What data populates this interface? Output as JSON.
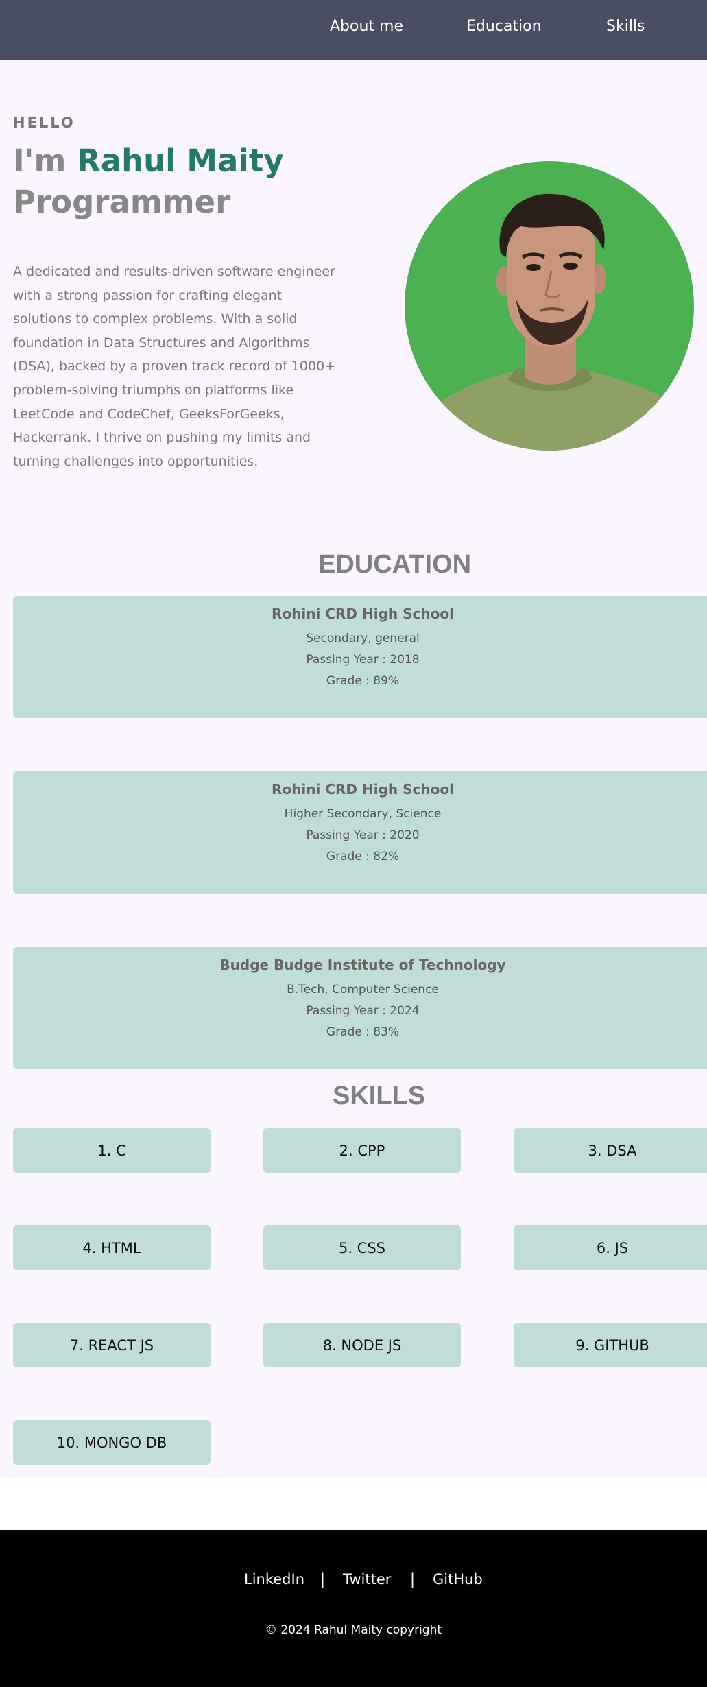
{
  "nav": {
    "items": [
      "About me",
      "Education",
      "Skills"
    ]
  },
  "hero": {
    "hello": "HELLO",
    "intro": "I'm",
    "name": "Rahul Maity",
    "role": "Programmer",
    "bio": "A dedicated and results-driven software engineer with a strong passion for crafting elegant solutions to complex problems. With a solid foundation in Data Structures and Algorithms (DSA), backed by a proven track record of 1000+ problem-solving triumphs on platforms like LeetCode and CodeChef, GeeksForGeeks, Hackerrank. I thrive on pushing my limits and turning challenges into opportunities."
  },
  "education": {
    "title": "EDUCATION",
    "items": [
      {
        "school": "Rohini CRD High School",
        "level": "Secondary, general",
        "year": "Passing Year : 2018",
        "grade": "Grade : 89%"
      },
      {
        "school": "Rohini CRD High School",
        "level": "Higher Secondary, Science",
        "year": "Passing Year : 2020",
        "grade": "Grade : 82%"
      },
      {
        "school": "Budge Budge Institute of Technology",
        "level": "B.Tech, Computer Science",
        "year": "Passing Year : 2024",
        "grade": "Grade : 83%"
      }
    ]
  },
  "skills": {
    "title": "SKILLS",
    "items": [
      "1. C",
      "2. CPP",
      "3. DSA",
      "4. HTML",
      "5. CSS",
      "6. JS",
      "7. REACT JS",
      "8. NODE JS",
      "9. GITHUB",
      "10. MONGO DB"
    ]
  },
  "footer": {
    "links": [
      "LinkedIn",
      "Twitter",
      "GitHub"
    ],
    "separator": "|",
    "copyright": "© 2024 Rahul Maity copyright"
  },
  "colors": {
    "nav_bg": "#4a4e62",
    "page_bg": "#fbf5ff",
    "card_bg": "#c1ddd8",
    "accent": "#237a6c",
    "photo_bg": "#4cb151",
    "footer_bg": "#000000"
  }
}
